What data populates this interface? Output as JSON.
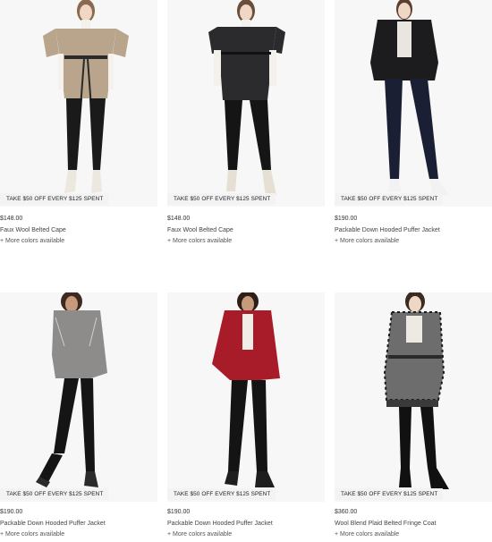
{
  "products": [
    {
      "promo": "TAKE $50 OFF EVERY $125 SPENT",
      "price": "$148.00",
      "name": "Faux Wool Belted Cape",
      "more": "+ More colors available",
      "coat_color": "#b9a48c"
    },
    {
      "promo": "TAKE $50 OFF EVERY $125 SPENT",
      "price": "$148.00",
      "name": "Faux Wool Belted Cape",
      "more": "+ More colors available",
      "coat_color": "#2b2b2e"
    },
    {
      "promo": "TAKE $50 OFF EVERY $125 SPENT",
      "price": "$190.00",
      "name": "Packable Down Hooded Puffer Jacket",
      "more": "+ More colors available",
      "coat_color": "#1c1c1e"
    },
    {
      "promo": "TAKE $50 OFF EVERY $125 SPENT",
      "price": "$190.00",
      "name": "Packable Down Hooded Puffer Jacket",
      "more": "+ More colors available",
      "coat_color": "#8e8c8a"
    },
    {
      "promo": "TAKE $50 OFF EVERY $125 SPENT",
      "price": "$190.00",
      "name": "Packable Down Hooded Puffer Jacket",
      "more": "+ More colors available",
      "coat_color": "#a81c2a"
    },
    {
      "promo": "TAKE $50 OFF EVERY $125 SPENT",
      "price": "$360.00",
      "name": "Wool Blend Plaid Belted Fringe Coat",
      "more": "+ More colors available",
      "coat_color": "#6d6d6d"
    }
  ]
}
